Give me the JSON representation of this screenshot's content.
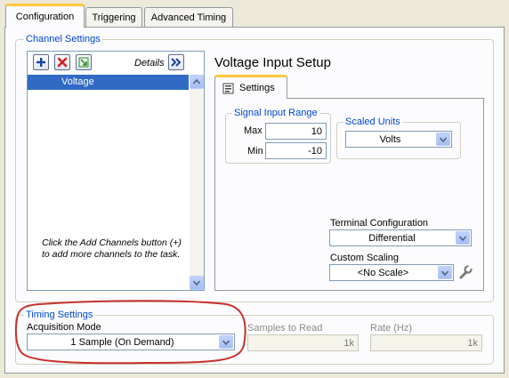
{
  "tabs": [
    {
      "label": "Configuration"
    },
    {
      "label": "Triggering"
    },
    {
      "label": "Advanced Timing"
    }
  ],
  "channel_settings": {
    "title": "Channel Settings",
    "details_label": "Details",
    "channels": [
      "Voltage"
    ],
    "help_text": "Click the Add Channels button (+) to add more channels to the task."
  },
  "voltage_setup": {
    "title": "Voltage Input Setup",
    "settings_tab": "Settings",
    "signal_range": {
      "title": "Signal Input Range",
      "max_label": "Max",
      "max_value": "10",
      "min_label": "Min",
      "min_value": "-10"
    },
    "scaled_units": {
      "title": "Scaled Units",
      "value": "Volts"
    },
    "terminal_config": {
      "label": "Terminal Configuration",
      "value": "Differential"
    },
    "custom_scaling": {
      "label": "Custom Scaling",
      "value": "<No Scale>"
    }
  },
  "timing_settings": {
    "title": "Timing Settings",
    "acquisition_mode_label": "Acquisition Mode",
    "acquisition_mode_value": "1 Sample (On Demand)",
    "samples_to_read_label": "Samples to Read",
    "samples_to_read_value": "1k",
    "rate_label": "Rate (Hz)",
    "rate_value": "1k"
  },
  "colors": {
    "highlight_ring": "#c8302c",
    "selection": "#316ac5",
    "group_title": "#0046d5"
  }
}
